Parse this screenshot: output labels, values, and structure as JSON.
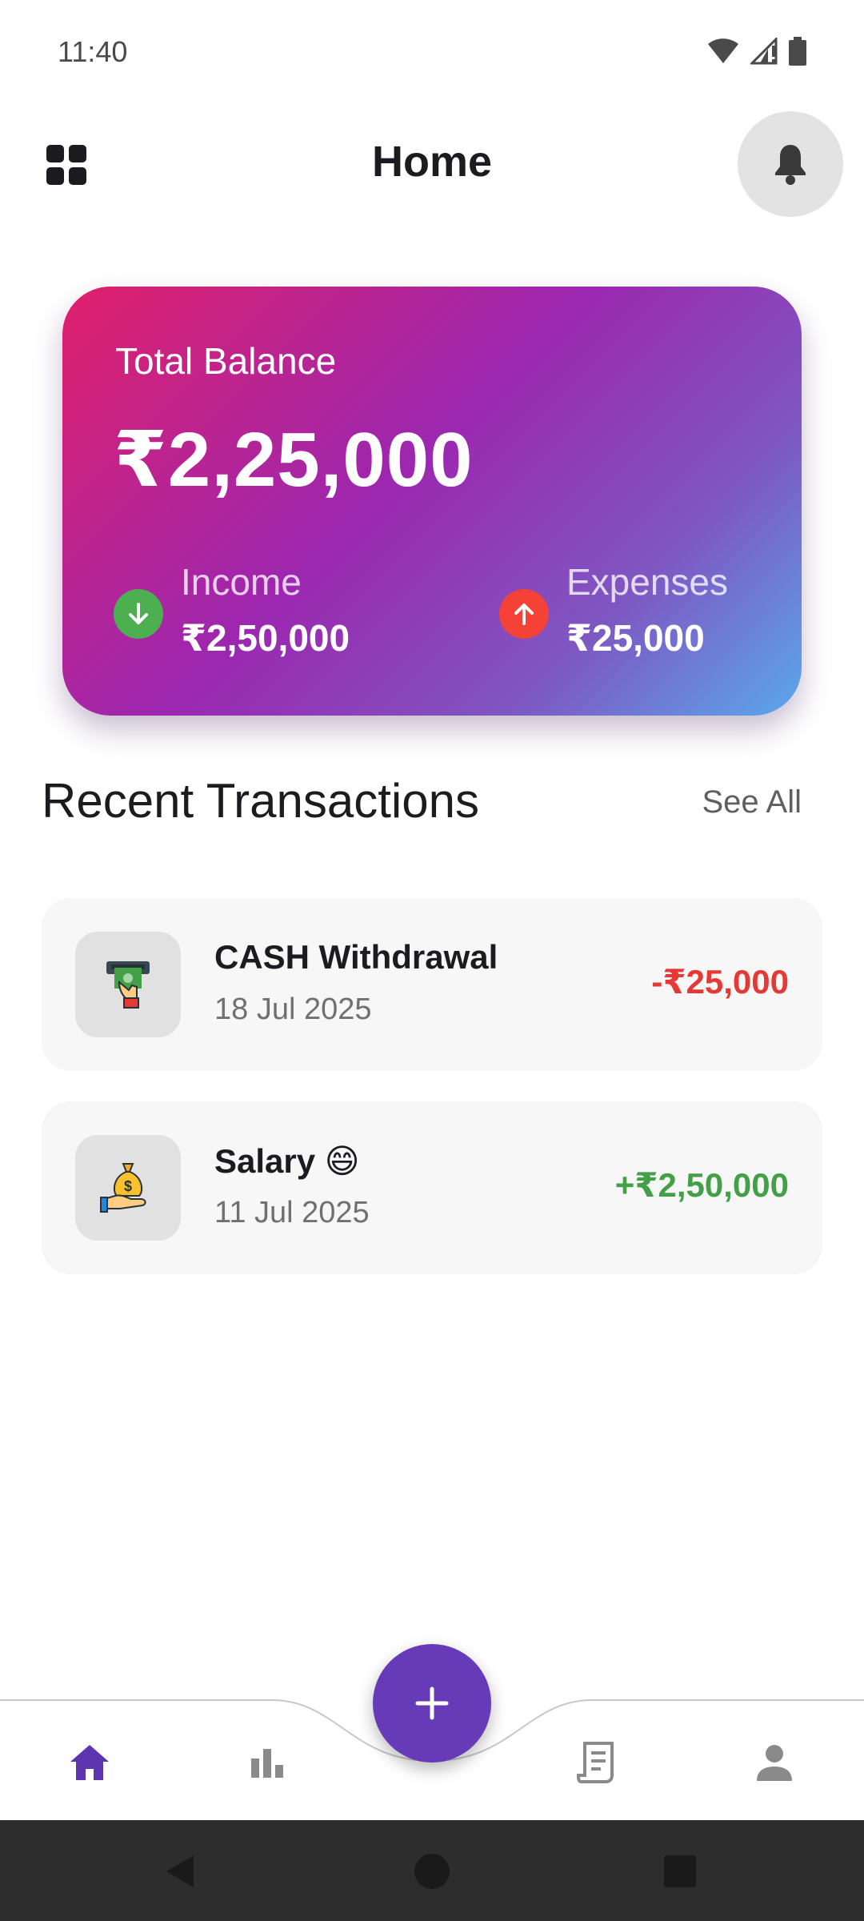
{
  "status_bar": {
    "time": "11:40"
  },
  "app_bar": {
    "title": "Home"
  },
  "balance_card": {
    "label": "Total Balance",
    "amount": "₹2,25,000",
    "income": {
      "label": "Income",
      "value": "₹2,50,000",
      "icon": "arrow-down-icon",
      "color": "#4caf50"
    },
    "expenses": {
      "label": "Expenses",
      "value": "₹25,000",
      "icon": "arrow-up-icon",
      "color": "#f44336"
    }
  },
  "recent": {
    "title": "Recent Transactions",
    "see_all": "See All",
    "items": [
      {
        "title": "CASH Withdrawal",
        "date": "18 Jul 2025",
        "amount": "-₹25,000",
        "amount_color": "#e53935",
        "icon": "atm-withdrawal-icon"
      },
      {
        "title": "Salary 😄",
        "date": "11 Jul 2025",
        "amount": "+₹2,50,000",
        "amount_color": "#43a047",
        "icon": "money-bag-hand-icon"
      }
    ]
  },
  "bottom_nav": {
    "items": [
      "home-icon",
      "chart-icon",
      "receipt-icon",
      "person-icon"
    ],
    "active": "home-icon",
    "active_color": "#5e35b1",
    "inactive_color": "#8a8a8a",
    "fab_color": "#673ab7"
  }
}
